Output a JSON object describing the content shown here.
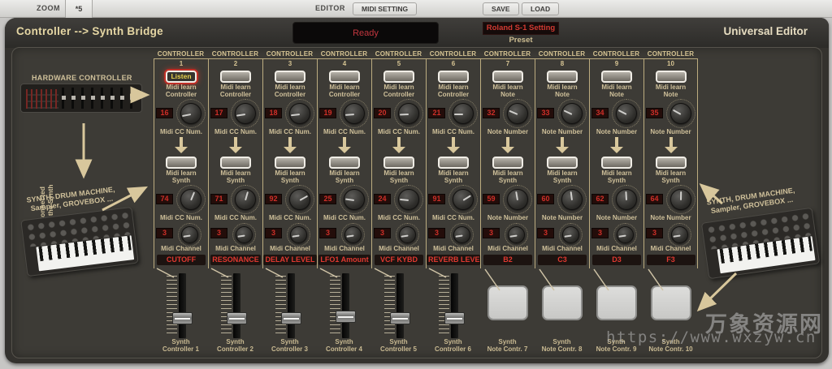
{
  "toolbar": {
    "zoom": "ZOOM",
    "zoom_factor": "*5",
    "editor": "EDITOR",
    "midi_setting": "MIDI SETTING",
    "save": "SAVE",
    "load": "LOAD"
  },
  "header": {
    "title": "Controller --> Synth Bridge",
    "status": "Ready",
    "preset_value": "Roland S-1 Setting",
    "preset_label": "Preset",
    "brand": "Universal Editor"
  },
  "left_panel": {
    "hardware_label": "HARDWARE CONTROLLER",
    "connected": [
      "Connected",
      "to the Synth"
    ],
    "synth_caption": [
      "SYNTH, DRUM MACHINE,",
      "Sampler, GROVEBOX ..."
    ]
  },
  "right_panel": {
    "synth_caption": [
      "SYNTH, DRUM MACHINE,",
      "Sampler, GROVEBOX ..."
    ]
  },
  "watermark": {
    "line1": "万象资源网",
    "line2": "https://www.wxzyw.cn"
  },
  "colors": {
    "accent_tan": "#d8c79c",
    "display_red": "#cf2f28",
    "label_red": "#e03830"
  },
  "strips": [
    {
      "header": "CONTROLLER",
      "number": "1",
      "top_button": "Listen",
      "listen": true,
      "learn_top": [
        "Midi learn",
        "Controller"
      ],
      "value_top": "16",
      "value_top_label": "Midi CC Num.",
      "learn_synth": [
        "Midi learn",
        "Synth"
      ],
      "value_synth": "74",
      "value_synth_label": "Midi CC Num.",
      "channel": "3",
      "channel_label": "Midi Channel",
      "assign": "CUTOFF",
      "control": "fader",
      "fader_pos": 0.75,
      "bottom": [
        "Synth",
        "Controller 1"
      ]
    },
    {
      "header": "CONTROLLER",
      "number": "2",
      "top_button": "",
      "listen": false,
      "learn_top": [
        "Midi learn",
        "Controller"
      ],
      "value_top": "17",
      "value_top_label": "Midi CC Num.",
      "learn_synth": [
        "Midi learn",
        "Synth"
      ],
      "value_synth": "71",
      "value_synth_label": "Midi CC Num.",
      "channel": "3",
      "channel_label": "Midi Channel",
      "assign": "RESONANCE",
      "control": "fader",
      "fader_pos": 0.75,
      "bottom": [
        "Synth",
        "Controller 2"
      ]
    },
    {
      "header": "CONTROLLER",
      "number": "3",
      "top_button": "",
      "listen": false,
      "learn_top": [
        "Midi learn",
        "Controller"
      ],
      "value_top": "18",
      "value_top_label": "Midi CC Num.",
      "learn_synth": [
        "Midi learn",
        "Synth"
      ],
      "value_synth": "92",
      "value_synth_label": "Midi CC Num.",
      "channel": "3",
      "channel_label": "Midi Channel",
      "assign": "DELAY LEVEL",
      "control": "fader",
      "fader_pos": 0.75,
      "bottom": [
        "Synth",
        "Controller 3"
      ]
    },
    {
      "header": "CONTROLLER",
      "number": "4",
      "top_button": "",
      "listen": false,
      "learn_top": [
        "Midi learn",
        "Controller"
      ],
      "value_top": "19",
      "value_top_label": "Midi CC Num.",
      "learn_synth": [
        "Midi learn",
        "Synth"
      ],
      "value_synth": "25",
      "value_synth_label": "Midi CC Num.",
      "channel": "3",
      "channel_label": "Midi Channel",
      "assign": "LFO1 Amount",
      "control": "fader",
      "fader_pos": 0.72,
      "bottom": [
        "Synth",
        "Controller 4"
      ]
    },
    {
      "header": "CONTROLLER",
      "number": "5",
      "top_button": "",
      "listen": false,
      "learn_top": [
        "Midi learn",
        "Controller"
      ],
      "value_top": "20",
      "value_top_label": "Midi CC Num.",
      "learn_synth": [
        "Midi learn",
        "Synth"
      ],
      "value_synth": "24",
      "value_synth_label": "Midi CC Num.",
      "channel": "3",
      "channel_label": "Midi Channel",
      "assign": "VCF KYBD",
      "control": "fader",
      "fader_pos": 0.75,
      "bottom": [
        "Synth",
        "Controller 5"
      ]
    },
    {
      "header": "CONTROLLER",
      "number": "6",
      "top_button": "",
      "listen": false,
      "learn_top": [
        "Midi learn",
        "Controller"
      ],
      "value_top": "21",
      "value_top_label": "Midi CC Num.",
      "learn_synth": [
        "Midi learn",
        "Synth"
      ],
      "value_synth": "91",
      "value_synth_label": "Midi CC Num.",
      "channel": "3",
      "channel_label": "Midi Channel",
      "assign": "REVERB LEVEL",
      "control": "fader",
      "fader_pos": 0.75,
      "bottom": [
        "Synth",
        "Controller 6"
      ]
    },
    {
      "header": "CONTROLLER",
      "number": "7",
      "top_button": "",
      "listen": false,
      "learn_top": [
        "Midi learn",
        "Note"
      ],
      "value_top": "32",
      "value_top_label": "Note Number",
      "learn_synth": [
        "Midi learn",
        "Synth"
      ],
      "value_synth": "59",
      "value_synth_label": "Note Number",
      "channel": "3",
      "channel_label": "Midi Channel",
      "assign": "B2",
      "control": "pad",
      "bottom": [
        "Synth",
        "Note Contr. 7"
      ]
    },
    {
      "header": "CONTROLLER",
      "number": "8",
      "top_button": "",
      "listen": false,
      "learn_top": [
        "Midi learn",
        "Note"
      ],
      "value_top": "33",
      "value_top_label": "Note Number",
      "learn_synth": [
        "Midi learn",
        "Synth"
      ],
      "value_synth": "60",
      "value_synth_label": "Note Number",
      "channel": "3",
      "channel_label": "Midi Channel",
      "assign": "C3",
      "control": "pad",
      "bottom": [
        "Synth",
        "Note Contr. 8"
      ]
    },
    {
      "header": "CONTROLLER",
      "number": "9",
      "top_button": "",
      "listen": false,
      "learn_top": [
        "Midi learn",
        "Note"
      ],
      "value_top": "34",
      "value_top_label": "Note Number",
      "learn_synth": [
        "Midi learn",
        "Synth"
      ],
      "value_synth": "62",
      "value_synth_label": "Note Number",
      "channel": "3",
      "channel_label": "Midi Channel",
      "assign": "D3",
      "control": "pad",
      "bottom": [
        "Synth",
        "Note Contr. 9"
      ]
    },
    {
      "header": "CONTROLLER",
      "number": "10",
      "top_button": "",
      "listen": false,
      "learn_top": [
        "Midi learn",
        "Note"
      ],
      "value_top": "35",
      "value_top_label": "Note Number",
      "learn_synth": [
        "Midi learn",
        "Synth"
      ],
      "value_synth": "64",
      "value_synth_label": "Note Number",
      "channel": "3",
      "channel_label": "Midi Channel",
      "assign": "F3",
      "control": "pad",
      "bottom": [
        "Synth",
        "Note Contr. 10"
      ]
    }
  ]
}
